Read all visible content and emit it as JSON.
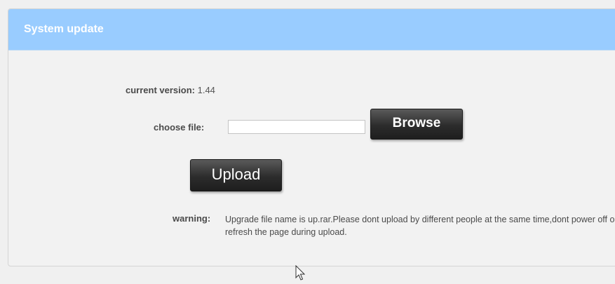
{
  "panel": {
    "title": "System update"
  },
  "form": {
    "current_version_label": "current version:",
    "current_version_value": "1.44",
    "choose_file_label": "choose file:",
    "file_input_value": "",
    "browse_label": "Browse",
    "upload_label": "Upload",
    "warning_label": "warning:",
    "warning_text": "Upgrade file name is up.rar.Please dont upload by different people at the same time,dont power off or refresh the page during upload."
  },
  "colors": {
    "header_bg": "#99ccff",
    "button_bg": "#2c2c2c"
  },
  "icons": {
    "cursor": "mouse-pointer-icon"
  }
}
